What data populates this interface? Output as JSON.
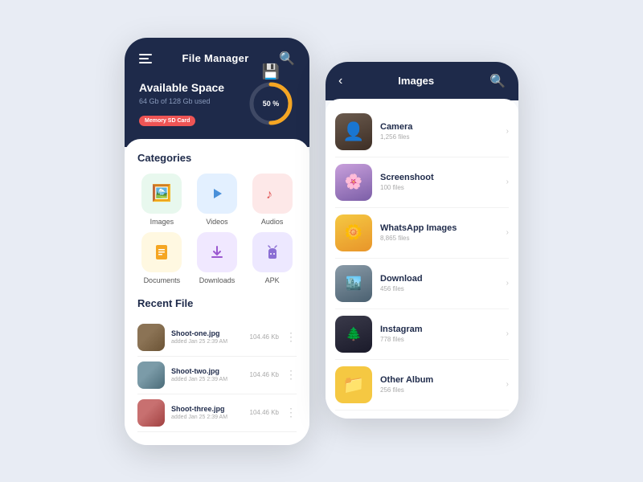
{
  "app": {
    "background": "#e8ecf4"
  },
  "left_phone": {
    "header": {
      "title": "File Manager",
      "menu_icon": "hamburger",
      "search_icon": "search"
    },
    "storage": {
      "title": "Available Space",
      "subtitle": "64 Gb of 128 Gb used",
      "badge": "Memory SD Card",
      "percent": "50 %",
      "percent_num": 50
    },
    "categories": {
      "title": "Categories",
      "items": [
        {
          "label": "Images",
          "icon": "🖼️",
          "bg": "green"
        },
        {
          "label": "Videos",
          "icon": "▶️",
          "bg": "blue"
        },
        {
          "label": "Audios",
          "icon": "🎵",
          "bg": "pink"
        },
        {
          "label": "Documents",
          "icon": "📄",
          "bg": "yellow"
        },
        {
          "label": "Downloads",
          "icon": "⬇️",
          "bg": "purple"
        },
        {
          "label": "APK",
          "icon": "🤖",
          "bg": "lavender"
        }
      ]
    },
    "recent_files": {
      "title": "Recent File",
      "items": [
        {
          "name": "Shoot-one.jpg",
          "meta": "added Jan 25 2:39 AM",
          "size": "104.46 Kb",
          "thumb": "thumb-1"
        },
        {
          "name": "Shoot-two.jpg",
          "meta": "added Jan 25 2:39 AM",
          "size": "104.46 Kb",
          "thumb": "thumb-2"
        },
        {
          "name": "Shoot-three.jpg",
          "meta": "added Jan 25 2:39 AM",
          "size": "104.46 Kb",
          "thumb": "thumb-3"
        }
      ]
    }
  },
  "right_phone": {
    "header": {
      "title": "Images",
      "back_icon": "back",
      "search_icon": "search"
    },
    "albums": [
      {
        "name": "Camera",
        "count": "1,256 files",
        "thumb_class": "at-camera"
      },
      {
        "name": "Screenshoot",
        "count": "100 files",
        "thumb_class": "at-screenshot"
      },
      {
        "name": "WhatsApp Images",
        "count": "8,865 files",
        "thumb_class": "at-whatsapp"
      },
      {
        "name": "Download",
        "count": "456 files",
        "thumb_class": "at-download"
      },
      {
        "name": "Instagram",
        "count": "778 files",
        "thumb_class": "at-instagram"
      },
      {
        "name": "Other Album",
        "count": "256 files",
        "thumb_class": "at-other"
      }
    ]
  }
}
